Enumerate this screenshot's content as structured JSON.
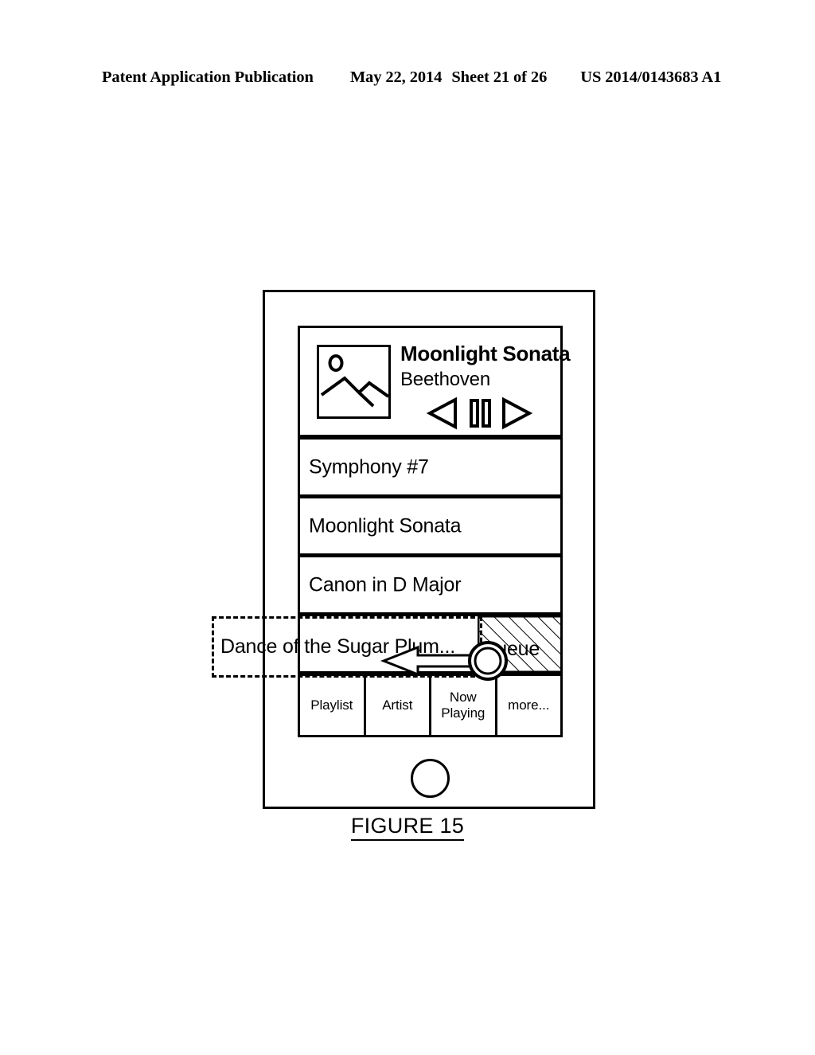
{
  "page_header": {
    "publication": "Patent Application Publication",
    "date": "May 22, 2014",
    "sheet": "Sheet 21 of 26",
    "doc_number": "US 2014/0143683 A1"
  },
  "figure": {
    "caption": "FIGURE 15"
  },
  "device": {
    "home_button": "home-button"
  },
  "now_playing": {
    "album_art_icon": "image-placeholder-icon",
    "title": "Moonlight Sonata",
    "artist": "Beethoven",
    "controls": [
      {
        "name": "previous-button",
        "icon": "triangle-left-outline"
      },
      {
        "name": "pause-button",
        "icon": "pause-bars-outline"
      },
      {
        "name": "next-button",
        "icon": "triangle-right-outline"
      }
    ]
  },
  "tracklist": [
    {
      "label": "Symphony #7"
    },
    {
      "label": "Moonlight Sonata"
    },
    {
      "label": "Canon in D Major"
    },
    {
      "label": "Dance of the Sugar Plum..."
    }
  ],
  "queue": {
    "label": "Queue",
    "fill": "diagonal-hatch"
  },
  "tabbar": [
    {
      "label": "Playlist"
    },
    {
      "label": "Artist"
    },
    {
      "label": "Now\nPlaying"
    },
    {
      "label": "more..."
    }
  ],
  "annotation": {
    "callout_text": "Dance of the Sugar Plum...",
    "touch_point_icon": "touch-circle-icon",
    "drag_arrow_icon": "arrow-left-icon"
  },
  "colors": {
    "ink": "#000000",
    "paper": "#ffffff"
  }
}
